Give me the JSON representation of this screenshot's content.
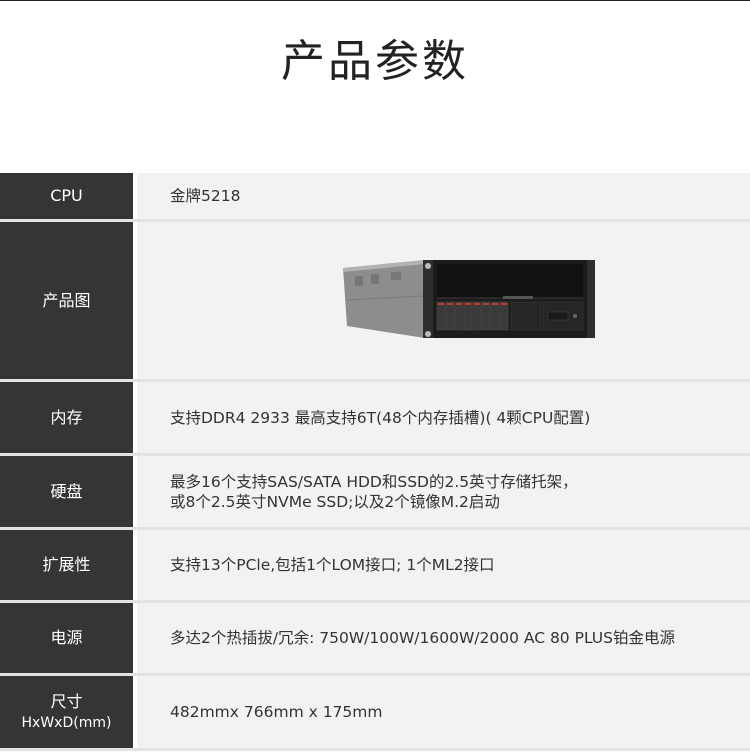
{
  "page": {
    "title": "产品参数"
  },
  "specs": {
    "cpu": {
      "label": "CPU",
      "value": "金牌5218"
    },
    "image": {
      "label": "产品图"
    },
    "memory": {
      "label": "内存",
      "value": "支持DDR4 2933 最高支持6T(48个内存插槽)( 4颗CPU配置)"
    },
    "disk": {
      "label": "硬盘",
      "line1": "最多16个支持SAS/SATA HDD和SSD的2.5英寸存储托架，",
      "line2": "或8个2.5英寸NVMe SSD;以及2个镜像M.2启动"
    },
    "expansion": {
      "label": "扩展性",
      "value": "支持13个PCle,包括1个LOM接口; 1个ML2接口"
    },
    "power": {
      "label": "电源",
      "value": "多达2个热插拔/冗余: 750W/100W/1600W/2000 AC 80 PLUS铂金电源"
    },
    "size": {
      "label": "尺寸",
      "sublabel": "HxWxD(mm)",
      "value": "482mmx 766mm x 175mm"
    }
  },
  "colors": {
    "label_bg": "#353535",
    "value_bg": "#f2f2f2",
    "accent": "#c0392b"
  }
}
